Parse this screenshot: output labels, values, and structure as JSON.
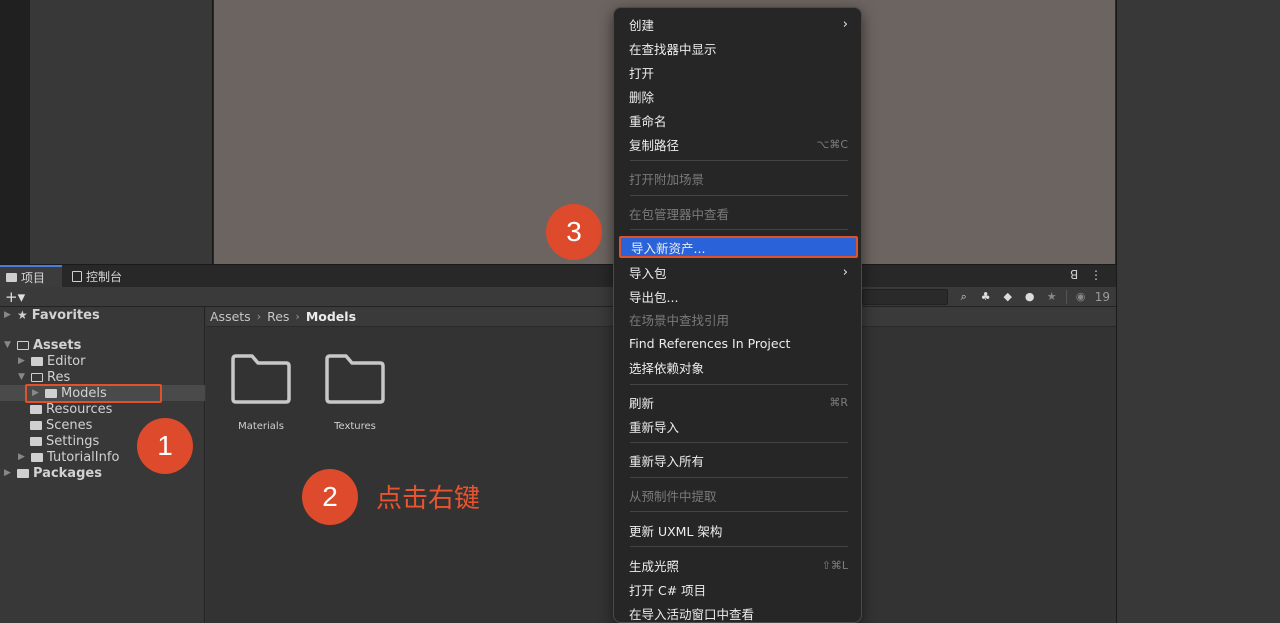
{
  "tabs": {
    "project": "项目",
    "console": "控制台"
  },
  "toolbar": {
    "add": "+▾",
    "hidden_count": "19"
  },
  "breadcrumb": {
    "assets": "Assets",
    "res": "Res",
    "models": "Models"
  },
  "tree": {
    "favorites": "Favorites",
    "assets": "Assets",
    "editor": "Editor",
    "res": "Res",
    "models": "Models",
    "resources": "Resources",
    "scenes": "Scenes",
    "settings": "Settings",
    "tutorialinfo": "TutorialInfo",
    "packages": "Packages"
  },
  "folders": [
    "Materials",
    "Textures"
  ],
  "steps": {
    "one": "1",
    "two": "2",
    "three": "3",
    "hint": "点击右键"
  },
  "menu": {
    "create": "创建",
    "reveal": "在查找器中显示",
    "open": "打开",
    "delete": "删除",
    "rename": "重命名",
    "copy_path": "复制路径",
    "copy_path_sc": "⌥⌘C",
    "open_additive": "打开附加场景",
    "view_pkg_mgr": "在包管理器中查看",
    "import_new": "导入新资产...",
    "import_pkg": "导入包",
    "export_pkg": "导出包...",
    "find_refs_scene": "在场景中查找引用",
    "find_refs_project": "Find References In Project",
    "select_deps": "选择依赖对象",
    "refresh": "刷新",
    "refresh_sc": "⌘R",
    "reimport": "重新导入",
    "reimport_all": "重新导入所有",
    "extract_prefab": "从预制件中提取",
    "update_uxml": "更新 UXML 架构",
    "gen_lighting": "生成光照",
    "gen_lighting_sc": "⇧⌘L",
    "open_csharp": "打开 C# 项目",
    "view_import_activity": "在导入活动窗口中查看"
  },
  "colors": {
    "accent": "#2a63d9",
    "annotation": "#e0522a",
    "scene": "#6c6460"
  }
}
